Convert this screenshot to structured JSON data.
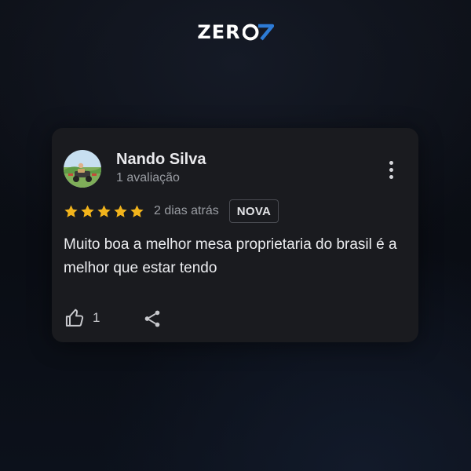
{
  "brand": {
    "logo_text": "ZERO7"
  },
  "review": {
    "reviewer_name": "Nando Silva",
    "review_count": "1 avaliação",
    "rating": 5,
    "rating_max": 5,
    "date": "2 dias atrás",
    "badge": "NOVA",
    "text": "Muito boa a melhor mesa proprietaria do brasil é a melhor que estar tendo",
    "likes": "1"
  },
  "icons": {
    "avatar": "avatar-image",
    "more": "more-vertical-icon",
    "star": "star-icon",
    "like": "thumbs-up-icon",
    "share": "share-icon"
  },
  "colors": {
    "star": "#f2b41c",
    "card_bg": "#1a1b1f",
    "logo_accent": "#2d7bd6"
  }
}
